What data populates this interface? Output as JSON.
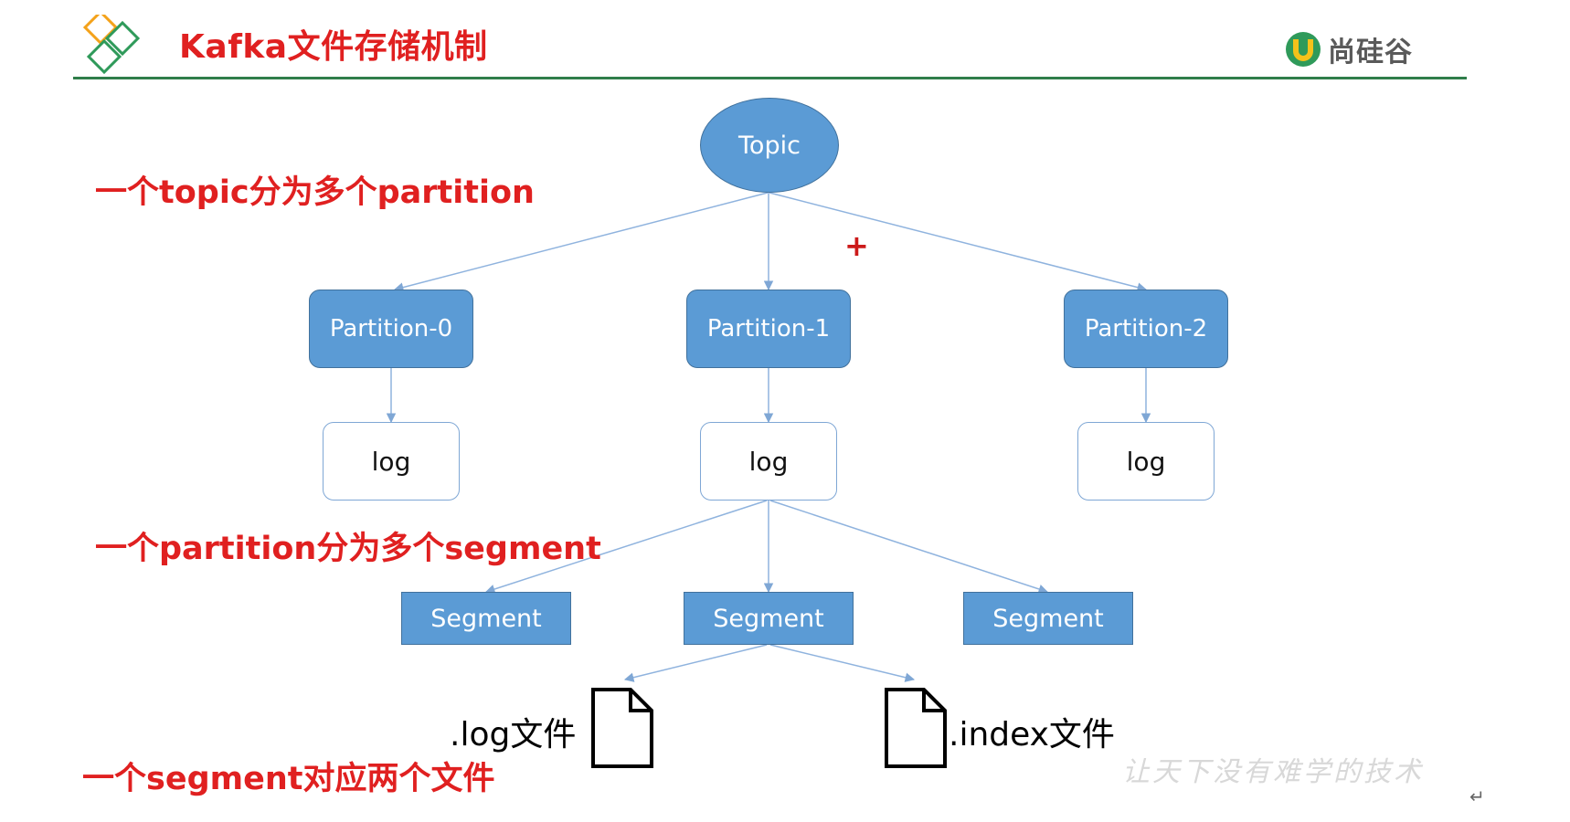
{
  "header": {
    "title": "Kafka文件存储机制",
    "brand": "尚硅谷"
  },
  "diagram": {
    "topic": "Topic",
    "partitions": [
      "Partition-0",
      "Partition-1",
      "Partition-2"
    ],
    "logs": [
      "log",
      "log",
      "log"
    ],
    "segments": [
      "Segment",
      "Segment",
      "Segment"
    ],
    "files": [
      ".log文件",
      ".index文件"
    ]
  },
  "notes": {
    "topic_note": "一个topic分为多个partition",
    "partition_note": "一个partition分为多个segment",
    "segment_note": "一个segment对应两个文件"
  },
  "footer": {
    "watermark": "让天下没有难学的技术",
    "return_mark": "↵"
  },
  "annotation": {
    "plus": "+"
  },
  "colors": {
    "title_red": "#e02020",
    "node_blue": "#5b9bd5",
    "line_blue": "#8fb3de",
    "header_green": "#2f7d4a"
  }
}
